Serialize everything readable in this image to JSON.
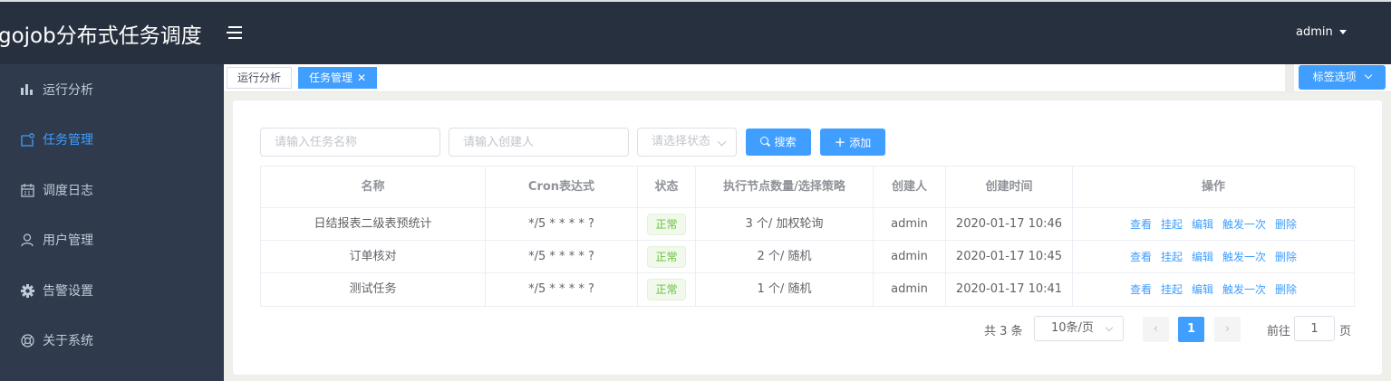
{
  "header": {
    "app_title": "gojob分布式任务调度",
    "user": "admin"
  },
  "sidebar": {
    "items": [
      {
        "label": "运行分析",
        "icon": "bar-chart-icon",
        "active": false
      },
      {
        "label": "任务管理",
        "icon": "task-icon",
        "active": true
      },
      {
        "label": "调度日志",
        "icon": "calendar-icon",
        "active": false
      },
      {
        "label": "用户管理",
        "icon": "user-icon",
        "active": false
      },
      {
        "label": "告警设置",
        "icon": "gear-icon",
        "active": false
      },
      {
        "label": "关于系统",
        "icon": "lifebuoy-icon",
        "active": false
      }
    ]
  },
  "tags": {
    "items": [
      {
        "label": "运行分析",
        "active": false
      },
      {
        "label": "任务管理",
        "active": true,
        "closable": true
      }
    ],
    "options_label": "标签选项"
  },
  "filters": {
    "task_name_placeholder": "请输入任务名称",
    "creator_placeholder": "请输入创建人",
    "status_placeholder": "请选择状态",
    "search_label": "搜索",
    "add_label": "添加"
  },
  "table": {
    "columns": [
      "名称",
      "Cron表达式",
      "状态",
      "执行节点数量/选择策略",
      "创建人",
      "创建时间",
      "操作"
    ],
    "rows": [
      {
        "name": "日结报表二级表预统计",
        "cron": "*/5 * * * * ?",
        "status": "正常",
        "nodes": "3 个/ 加权轮询",
        "creator": "admin",
        "created": "2020-01-17 10:46"
      },
      {
        "name": "订单核对",
        "cron": "*/5 * * * * ?",
        "status": "正常",
        "nodes": "2 个/ 随机",
        "creator": "admin",
        "created": "2020-01-17 10:45"
      },
      {
        "name": "测试任务",
        "cron": "*/5 * * * * ?",
        "status": "正常",
        "nodes": "1 个/ 随机",
        "creator": "admin",
        "created": "2020-01-17 10:41"
      }
    ],
    "actions": [
      "查看",
      "挂起",
      "编辑",
      "触发一次",
      "删除"
    ]
  },
  "pagination": {
    "total": "共 3 条",
    "page_size": "10条/页",
    "current_page": "1",
    "goto_label": "前往",
    "goto_value": "1",
    "page_suffix": "页"
  }
}
